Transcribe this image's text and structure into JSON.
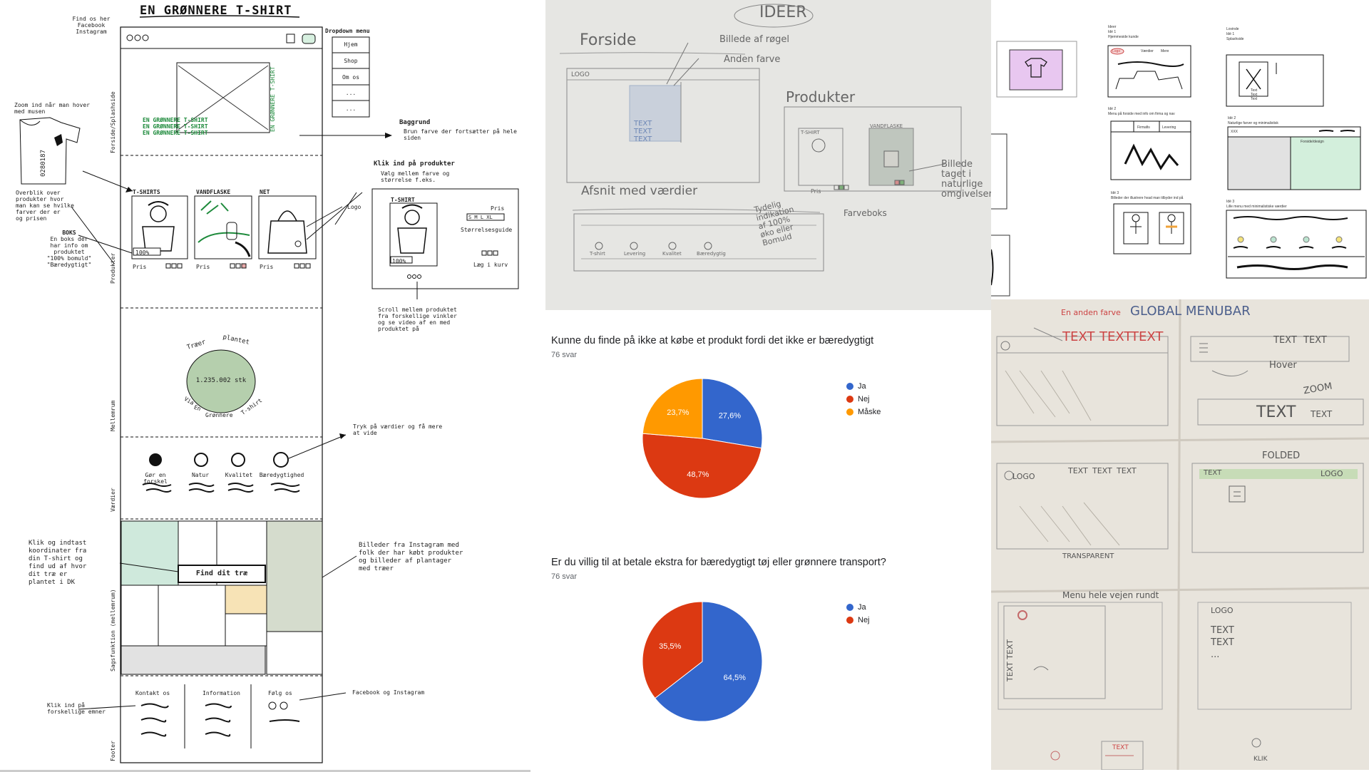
{
  "wireframe": {
    "title": "EN GRØNNERE T-SHIRT",
    "find_us": [
      "Find os her",
      "Facebook",
      "Instagram"
    ],
    "dropdown": {
      "heading": "Dropdown menu",
      "items": [
        "Hjem",
        "Shop",
        "Om os",
        "...",
        "..."
      ]
    },
    "hero_text": [
      "EN GRØNNERE T-SHIRT",
      "EN GRØNNERE T-SHIRT",
      "EN GRØNNERE T-SHIRT"
    ],
    "hero_vertical": "EN GRØNNERE T-SHIRT",
    "background_note": [
      "Baggrund",
      "Brun farve der fortsætter på hele siden"
    ],
    "zoom_note": [
      "Zoom ind når man hover",
      "med musen"
    ],
    "tshirt_code": "0280187",
    "overview_note": [
      "Overblik over",
      "produkter hvor",
      "man kan se hvilke",
      "farver der er",
      "og prisen"
    ],
    "boks_note": [
      "BOKS",
      "En boks der",
      "har info om",
      "produktet",
      "\"100% bomuld\"",
      "\"Bæredygtigt\""
    ],
    "products": [
      {
        "category": "T-SHIRTS",
        "price": "Pris"
      },
      {
        "category": "VANDFLASKE",
        "price": "Pris"
      },
      {
        "category": "NET",
        "price": "Pris"
      }
    ],
    "badge_100": "100%",
    "logo_note": "Logo",
    "click_note": [
      "Klik ind på produkter",
      "Vælg mellem farve og",
      "størrelse f.eks."
    ],
    "detail": {
      "label": "T-SHIRT",
      "price": "Pris",
      "sizes": "S M L XL",
      "guide": "Størrelsesguide",
      "cart": "Læg i kurv"
    },
    "scroll_note": [
      "Scroll mellem produktet",
      "fra forskellige vinkler",
      "og se video af en med",
      "produktet på"
    ],
    "trees": {
      "top_left": "Træer",
      "top_right": "plantet",
      "count": "1.235.002 stk",
      "bottom": [
        "Via",
        "En",
        "Grønnere",
        "T-shirt"
      ]
    },
    "values_note": [
      "Tryk på værdier og få mere",
      "at vide"
    ],
    "values": [
      "Gør en forskel",
      "Natur",
      "Kvalitet",
      "Bæredygtighed"
    ],
    "find_tree": "Find dit træ",
    "coords_note": [
      "Klik og indtast",
      "koordinater fra",
      "din T-shirt og",
      "find ud af hvor",
      "dit træ er",
      "plantet i DK"
    ],
    "instagram_note": [
      "Billeder fra Instagram med",
      "folk der har købt produkter",
      "og billeder af plantager",
      "med træer"
    ],
    "footer": {
      "contact": "Kontakt os",
      "info": "Information",
      "follow": "Følg os"
    },
    "click_subjects": [
      "Klik ind på",
      "forskellige emner"
    ],
    "fb_insta": "Facebook og Instagram",
    "section_labels": [
      "Forside/Splashside",
      "Produkter",
      "Mellemrum",
      "Værdier",
      "Sagsfunktion (mellemrum)",
      "Footer"
    ]
  },
  "sketch": {
    "ideer": "IDEER",
    "forside": "Forside",
    "billede_rogel": "Billede af røgel",
    "anden_farve": "Anden farve",
    "logo": "LOGO",
    "text_lines": [
      "TEXT",
      "TEXT",
      "TEXT"
    ],
    "produkter": "Produkter",
    "tshirt": "T-SHIRT",
    "vandflaske": "VANDFLASKE",
    "pris": "Pris",
    "billede_note": [
      "Billede",
      "taget i",
      "naturlige",
      "omgivelser"
    ],
    "tydelig": [
      "Tydelig",
      "indikation",
      "af 100%",
      "øko eller",
      "Bomuld"
    ],
    "farveboks": "Farveboks",
    "afsnit": "Afsnit med værdier",
    "value_labels": [
      "T-shirt",
      "Levering",
      "Kvalitet",
      "Bæredygtig"
    ]
  },
  "forms": {
    "q1": {
      "title": "Kunne du finde på ikke at købe et produkt fordi det ikke er bæredygtigt",
      "count": "76 svar"
    },
    "q2": {
      "title": "Er du villig til at betale ekstra for bæredygtigt tøj eller grønnere transport?",
      "count": "76 svar"
    }
  },
  "chart_data": [
    {
      "type": "pie",
      "title": "Kunne du finde på ikke at købe et produkt fordi det ikke er bæredygtigt",
      "slices": [
        {
          "label": "Ja",
          "value": 27.6,
          "color": "#3366cc"
        },
        {
          "label": "Nej",
          "value": 48.7,
          "color": "#dc3912"
        },
        {
          "label": "Måske",
          "value": 23.7,
          "color": "#ff9900"
        }
      ],
      "legend": "right"
    },
    {
      "type": "pie",
      "title": "Er du villig til at betale ekstra for bæredygtigt tøj eller grønnere transport?",
      "slices": [
        {
          "label": "Ja",
          "value": 64.5,
          "color": "#3366cc"
        },
        {
          "label": "Nej",
          "value": 35.5,
          "color": "#dc3912"
        }
      ],
      "legend": "right"
    }
  ],
  "digital": {
    "col2_header": [
      "Ideer",
      "Idé 1",
      "Hjemmeside kunde"
    ],
    "logo_pill": "Logo",
    "nav": [
      "Værdier",
      "Mere"
    ],
    "idea2": [
      "Idé 2",
      "Menu på forside med info om firma og nav"
    ],
    "tabs": [
      "Firmafis",
      "Levering"
    ],
    "idea3": [
      "Idé 3",
      "Billeder der illustrere hvad man tilbyder ind på"
    ],
    "col3_header": [
      "Lovinde",
      "Idé 1",
      "Splashside"
    ],
    "splash_text": [
      "Text",
      "Text",
      "Text"
    ],
    "idea2b": [
      "Idé 2",
      "Naturlige farver og minimalistisk"
    ],
    "xxx": "XXX",
    "forside_label": "Forside/design",
    "idea3b": [
      "Idé 3",
      "Lille menu med minimalistiske værdier"
    ]
  },
  "paper": {
    "global": "GLOBAL MENUBAR",
    "anden_farve": "En anden farve",
    "texts": [
      "TEXT",
      "TEXT",
      "TEXT"
    ],
    "text_right": [
      "TEXT",
      "TEXT"
    ],
    "hover": "Hover",
    "zoom": "ZOOM",
    "text_big": "TEXT",
    "text_small": "TEXT",
    "logo1": "LOGO",
    "row2_texts": [
      "TEXT",
      "TEXT",
      "TEXT"
    ],
    "transparent": "TRANSPARENT",
    "foldet": "FOLDED",
    "logo2": "LOGO",
    "text_green": "TEXT",
    "menu_hele": "Menu hele vejen rundt",
    "text_vertical": "TEXT TEXT",
    "logo3": "LOGO",
    "text_col": [
      "TEXT",
      "TEXT",
      "..."
    ],
    "bottom_text": "TEXT",
    "klik": "KLIK"
  }
}
